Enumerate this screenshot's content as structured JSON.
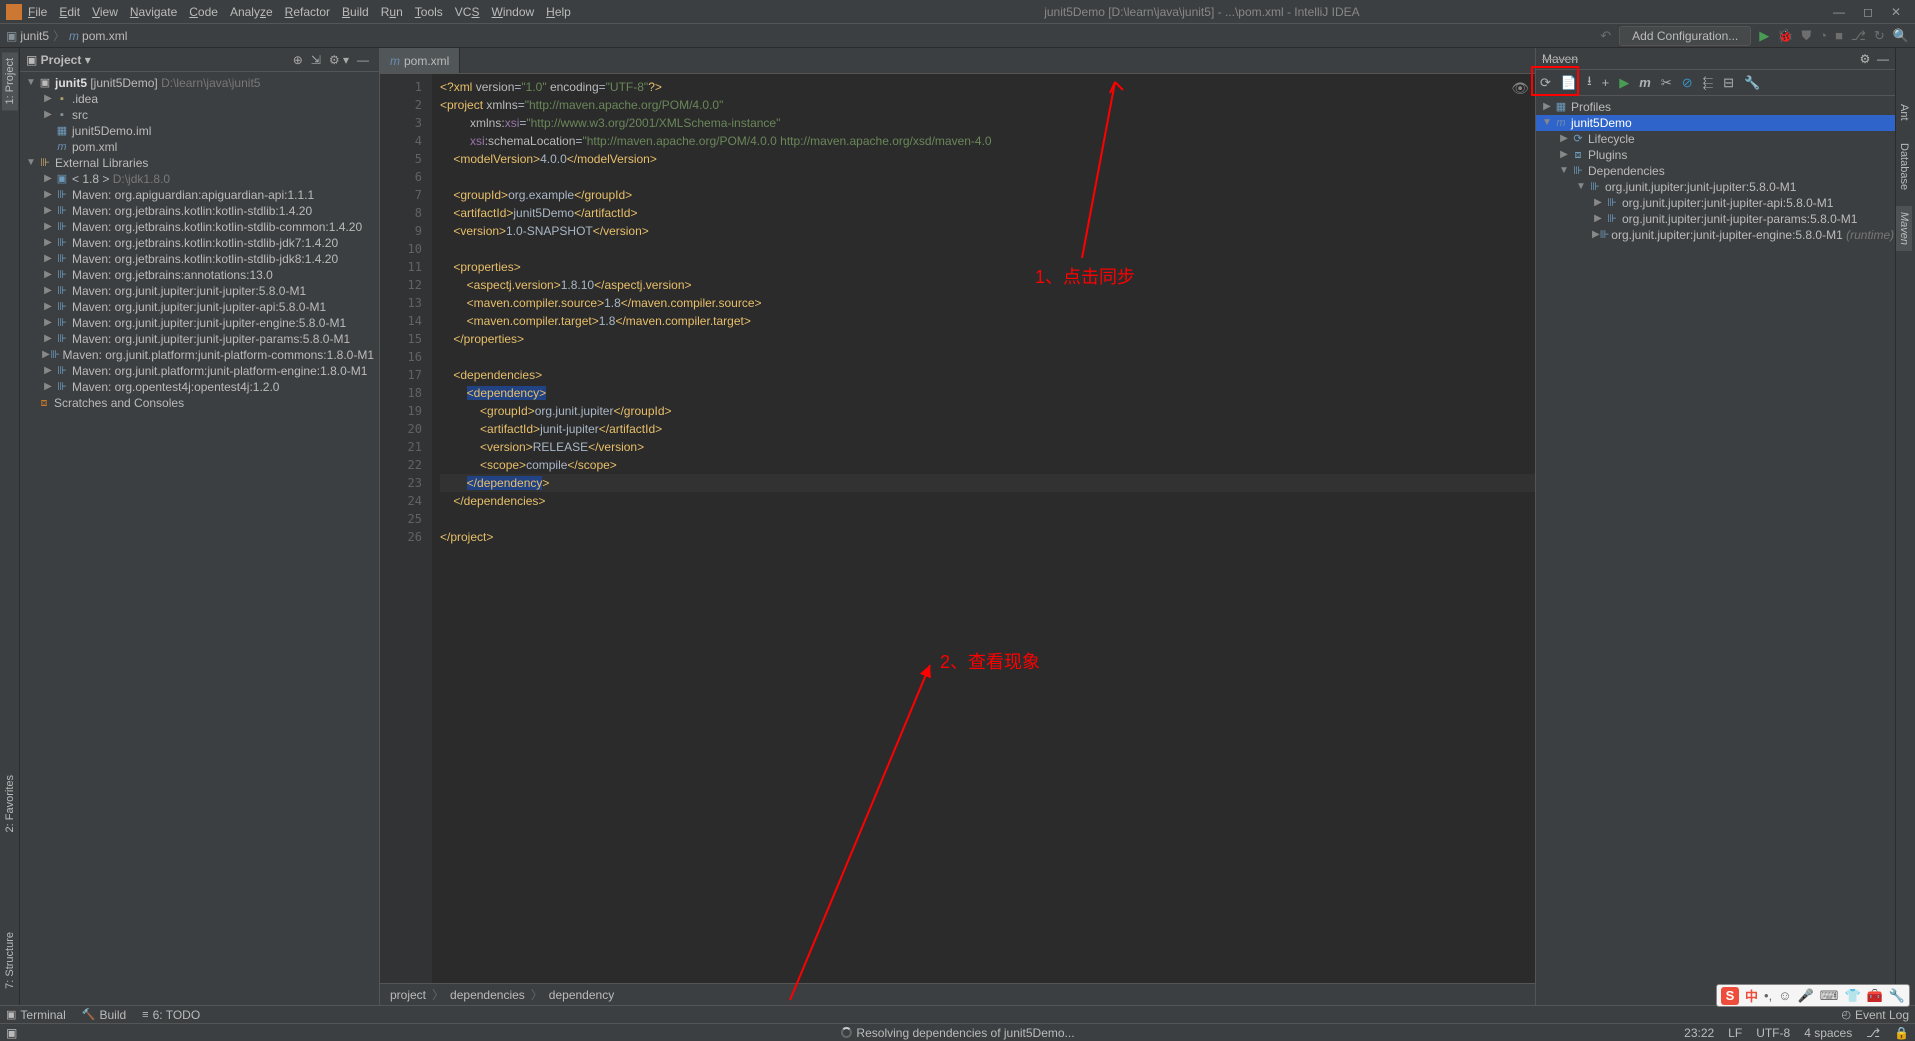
{
  "title": "junit5Demo [D:\\learn\\java\\junit5] - ...\\pom.xml - IntelliJ IDEA",
  "menus": [
    "File",
    "Edit",
    "View",
    "Navigate",
    "Code",
    "Analyze",
    "Refactor",
    "Build",
    "Run",
    "Tools",
    "VCS",
    "Window",
    "Help"
  ],
  "breadcrumb": {
    "p1": "junit5",
    "p2": "pom.xml"
  },
  "configBtn": "Add Configuration...",
  "projectPanel": {
    "title": "Project"
  },
  "tree": {
    "root": {
      "name": "junit5",
      "module": "[junit5Demo]",
      "path": "D:\\learn\\java\\junit5"
    },
    "idea": ".idea",
    "src": "src",
    "iml": "junit5Demo.iml",
    "pom": "pom.xml",
    "extLib": "External Libraries",
    "jdk": {
      "name": "< 1.8 >",
      "path": "D:\\jdk1.8.0"
    },
    "libs": [
      "Maven: org.apiguardian:apiguardian-api:1.1.1",
      "Maven: org.jetbrains.kotlin:kotlin-stdlib:1.4.20",
      "Maven: org.jetbrains.kotlin:kotlin-stdlib-common:1.4.20",
      "Maven: org.jetbrains.kotlin:kotlin-stdlib-jdk7:1.4.20",
      "Maven: org.jetbrains.kotlin:kotlin-stdlib-jdk8:1.4.20",
      "Maven: org.jetbrains:annotations:13.0",
      "Maven: org.junit.jupiter:junit-jupiter:5.8.0-M1",
      "Maven: org.junit.jupiter:junit-jupiter-api:5.8.0-M1",
      "Maven: org.junit.jupiter:junit-jupiter-engine:5.8.0-M1",
      "Maven: org.junit.jupiter:junit-jupiter-params:5.8.0-M1",
      "Maven: org.junit.platform:junit-platform-commons:1.8.0-M1",
      "Maven: org.junit.platform:junit-platform-engine:1.8.0-M1",
      "Maven: org.opentest4j:opentest4j:1.2.0"
    ],
    "scratch": "Scratches and Consoles"
  },
  "editor": {
    "tab": "pom.xml",
    "crumbs": [
      "project",
      "dependencies",
      "dependency"
    ],
    "lines": 26
  },
  "xml": {
    "l1": "<?xml version=\"1.0\" encoding=\"UTF-8\"?>",
    "projectOpen": "project",
    "xmlns": "http://maven.apache.org/POM/4.0.0",
    "xsiNs": "http://www.w3.org/2001/XMLSchema-instance",
    "schemaLoc": "http://maven.apache.org/POM/4.0.0 http://maven.apache.org/xsd/maven-4.0",
    "modelVersion": "4.0.0",
    "groupId": "org.example",
    "artifactId": "junit5Demo",
    "version": "1.0-SNAPSHOT",
    "aspectjVersion": "1.8.10",
    "compilerSource": "1.8",
    "compilerTarget": "1.8",
    "depGroupId": "org.junit.jupiter",
    "depArtifactId": "junit-jupiter",
    "depVersion": "RELEASE",
    "depScope": "compile"
  },
  "maven": {
    "title": "Maven",
    "profiles": "Profiles",
    "project": "junit5Demo",
    "lifecycle": "Lifecycle",
    "plugins": "Plugins",
    "dependencies": "Dependencies",
    "dep1": "org.junit.jupiter:junit-jupiter:5.8.0-M1",
    "dep1a": "org.junit.jupiter:junit-jupiter-api:5.8.0-M1",
    "dep1b": "org.junit.jupiter:junit-jupiter-params:5.8.0-M1",
    "dep1c": "org.junit.jupiter:junit-jupiter-engine:5.8.0-M1",
    "runtime": "(runtime)"
  },
  "statusTools": {
    "terminal": "Terminal",
    "build": "Build",
    "todo": "6: TODO",
    "eventLog": "Event Log"
  },
  "statusBar": {
    "resolving": "Resolving dependencies of junit5Demo...",
    "time": "23:22",
    "lf": "LF",
    "enc": "UTF-8",
    "indent": "4 spaces"
  },
  "annotations": {
    "a1": "1、点击同步",
    "a2": "2、查看现象"
  },
  "leftRail": {
    "project": "1: Project",
    "favorites": "2: Favorites",
    "structure": "7: Structure"
  },
  "rightRail": {
    "maven": "Maven",
    "ant": "Ant",
    "database": "Database"
  }
}
